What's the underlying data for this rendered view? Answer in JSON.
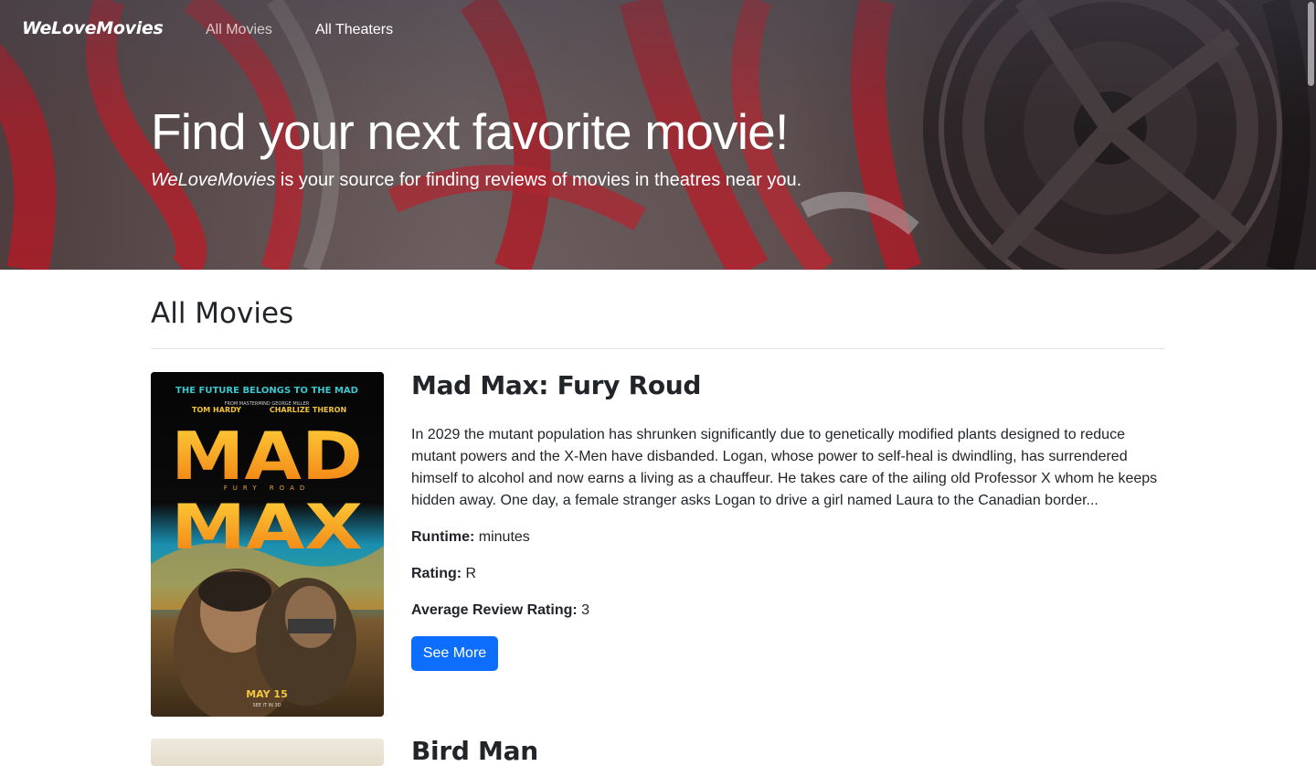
{
  "nav": {
    "brand": "WeLoveMovies",
    "links": [
      "All Movies",
      "All Theaters"
    ]
  },
  "hero": {
    "title": "Find your next favorite movie!",
    "subtitle_brand": "WeLoveMovies",
    "subtitle_rest": " is your source for finding reviews of movies in theatres near you."
  },
  "section": {
    "title": "All Movies"
  },
  "movies": [
    {
      "title": "Mad Max: Fury Roud",
      "description": "In 2029 the mutant population has shrunken significantly due to genetically modified plants designed to reduce mutant powers and the X-Men have disbanded. Logan, whose power to self-heal is dwindling, has surrendered himself to alcohol and now earns a living as a chauffeur. He takes care of the ailing old Professor X whom he keeps hidden away. One day, a female stranger asks Logan to drive a girl named Laura to the Canadian border...",
      "runtime_label": "Runtime:",
      "runtime_value": " minutes",
      "rating_label": "Rating:",
      "rating_value": " R",
      "avg_label": "Average Review Rating:",
      "avg_value": " 3",
      "button": "See More",
      "poster": {
        "tagline": "THE FUTURE BELONGS TO THE MAD",
        "credits_small": "FROM MASTERMIND GEORGE MILLER",
        "actor1": "TOM HARDY",
        "actor2": "CHARLIZE THERON",
        "word1": "MAD",
        "subtitle": "FURY ROAD",
        "word2": "MAX",
        "date": "MAY 15",
        "date_sub": "SEE IT IN 3D"
      }
    },
    {
      "title": "Bird Man (partially visible)"
    }
  ],
  "colors": {
    "primary_button": "#0d6efd",
    "text": "#212529",
    "divider": "#dee2e6"
  }
}
